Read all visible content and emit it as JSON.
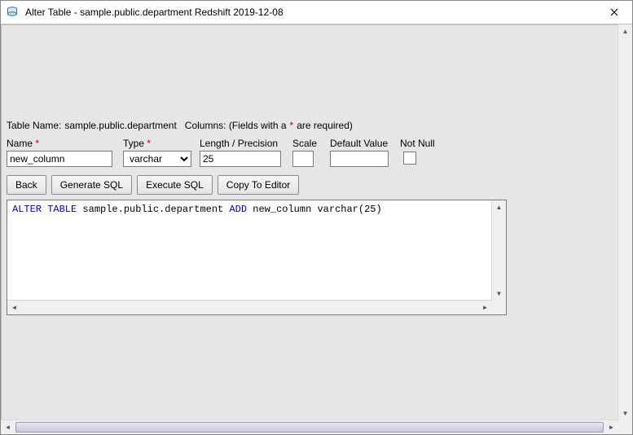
{
  "window": {
    "title": "Alter Table - sample.public.department Redshift 2019-12-08"
  },
  "info": {
    "table_label": "Table Name:",
    "table_name": "sample.public.department",
    "columns_label": "Columns: (Fields with a",
    "required_mark": "*",
    "columns_label_tail": "are required)"
  },
  "fields": {
    "name": {
      "label": "Name",
      "value": "new_column"
    },
    "type": {
      "label": "Type",
      "value": "varchar"
    },
    "length": {
      "label": "Length / Precision",
      "value": "25"
    },
    "scale": {
      "label": "Scale",
      "value": ""
    },
    "default": {
      "label": "Default Value",
      "value": ""
    },
    "notnull": {
      "label": "Not Null",
      "checked": false
    }
  },
  "buttons": {
    "back": "Back",
    "generate": "Generate SQL",
    "execute": "Execute SQL",
    "copy": "Copy To Editor"
  },
  "sql": {
    "kw_alter": "ALTER TABLE",
    "table": "sample.public.department",
    "kw_add": "ADD",
    "rest": "new_column varchar(25)"
  }
}
